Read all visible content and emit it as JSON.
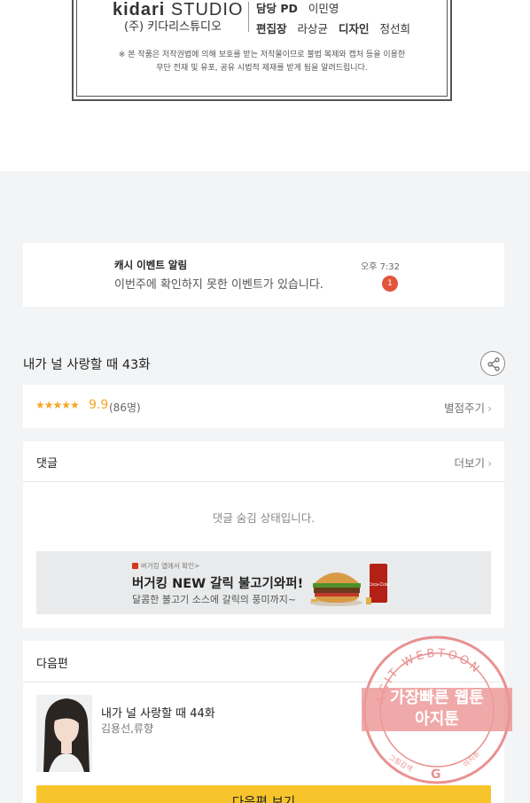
{
  "credits": {
    "studio_logo_light": "kidari",
    "studio_logo_rest": "STUDIO",
    "studio_name": "(주) 키다리스튜디오",
    "rows": [
      {
        "role": "담당 PD",
        "name": "이민영"
      },
      {
        "role": "편집장",
        "name": "라상균"
      },
      {
        "role": "디자인",
        "name": "정선희"
      }
    ],
    "copyright_line1": "※ 본 작품은 저작권법에 의해 보호를 받는 저작물이므로 불법 복제와 캡처 등을 이용한",
    "copyright_line2": "무단 전재 및 유포, 공유 시법적 제재를 받게 됨을 알려드립니다."
  },
  "notice": {
    "title": "캐시 이벤트 알림",
    "message": "이번주에 확인하지 못한 이벤트가 있습니다.",
    "time": "오후 7:32",
    "badge": "1"
  },
  "episode": {
    "title": "내가 널 사랑할 때 43화",
    "share_icon": "share-icon"
  },
  "rating": {
    "stars": "★★★★★",
    "score": "9.9",
    "count": "(86명)",
    "rate_label": "별점주기",
    "chevron": "›"
  },
  "comments": {
    "title": "댓글",
    "more_label": "더보기",
    "chevron": "›",
    "hidden_message": "댓글 숨김 상태입니다."
  },
  "ad": {
    "small_text": "버거킹 앱에서 확인>",
    "title": "버거킹 NEW 갈릭 불고기와퍼!",
    "description": "달콤한 불고기 소스에 갈릭의 풍미까지~",
    "cup_text": "Coca-Cola"
  },
  "next": {
    "title": "다음편",
    "episode_title": "내가 널 사랑할 때 44화",
    "authors": "김용선,류향",
    "button_label": "다음편 보기"
  },
  "watermark": {
    "top_text": "AGIT WEBTOON",
    "line1": "가장빠른 웹툰",
    "line2": "아지툰",
    "bottom_left": "그림감색",
    "bottom_right": "아지툰"
  },
  "colors": {
    "accent_yellow": "#f7c52b",
    "star_orange": "#f5a623",
    "badge_red": "#e2553b"
  }
}
